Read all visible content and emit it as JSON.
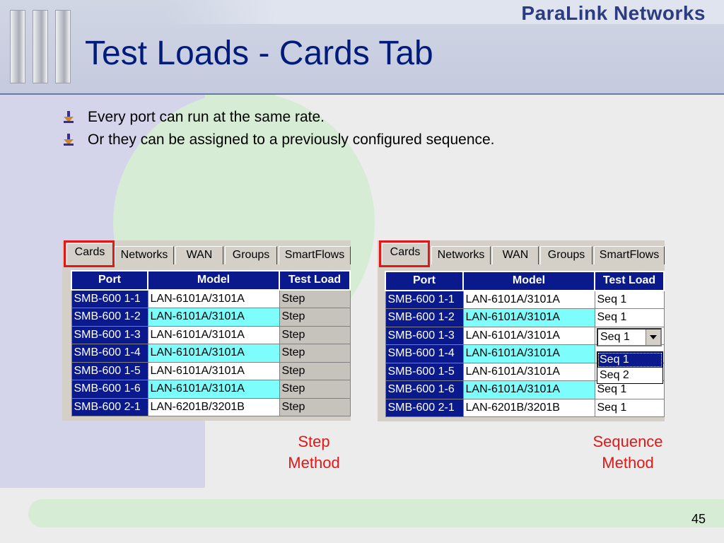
{
  "header": {
    "brand": "ParaLink Networks",
    "title": "Test Loads - Cards Tab"
  },
  "bullets": [
    "Every port can run at the same rate.",
    "Or they can be assigned to a previously configured sequence."
  ],
  "tabs": [
    "Cards",
    "Networks",
    "WAN",
    "Groups",
    "SmartFlows"
  ],
  "columns": {
    "port": "Port",
    "model": "Model",
    "load": "Test Load"
  },
  "step_table": {
    "rows": [
      {
        "port": "SMB-600 1-1",
        "model": "LAN-6101A/3101A",
        "load": "Step"
      },
      {
        "port": "SMB-600 1-2",
        "model": "LAN-6101A/3101A",
        "load": "Step"
      },
      {
        "port": "SMB-600 1-3",
        "model": "LAN-6101A/3101A",
        "load": "Step"
      },
      {
        "port": "SMB-600 1-4",
        "model": "LAN-6101A/3101A",
        "load": "Step"
      },
      {
        "port": "SMB-600 1-5",
        "model": "LAN-6101A/3101A",
        "load": "Step"
      },
      {
        "port": "SMB-600 1-6",
        "model": "LAN-6101A/3101A",
        "load": "Step"
      },
      {
        "port": "SMB-600 2-1",
        "model": "LAN-6201B/3201B",
        "load": "Step"
      }
    ]
  },
  "seq_table": {
    "rows": [
      {
        "port": "SMB-600 1-1",
        "model": "LAN-6101A/3101A",
        "load": "Seq 1"
      },
      {
        "port": "SMB-600 1-2",
        "model": "LAN-6101A/3101A",
        "load": "Seq 1"
      },
      {
        "port": "SMB-600 1-3",
        "model": "LAN-6101A/3101A",
        "load": ""
      },
      {
        "port": "SMB-600 1-4",
        "model": "LAN-6101A/3101A",
        "load": ""
      },
      {
        "port": "SMB-600 1-5",
        "model": "LAN-6101A/3101A",
        "load": ""
      },
      {
        "port": "SMB-600 1-6",
        "model": "LAN-6101A/3101A",
        "load": "Seq 1"
      },
      {
        "port": "SMB-600 2-1",
        "model": "LAN-6201B/3201B",
        "load": "Seq 1"
      }
    ],
    "combo_value": "Seq 1",
    "dropdown_options": [
      "Seq 1",
      "Seq 2"
    ]
  },
  "captions": {
    "step_line1": "Step",
    "step_line2": "Method",
    "seq_line1": "Sequence",
    "seq_line2": "Method"
  },
  "page_number": "45",
  "colors": {
    "title": "#001b7a",
    "header_cell": "#0a1a8c",
    "cyan_row": "#7efdfd",
    "highlight_red": "#e01818"
  }
}
